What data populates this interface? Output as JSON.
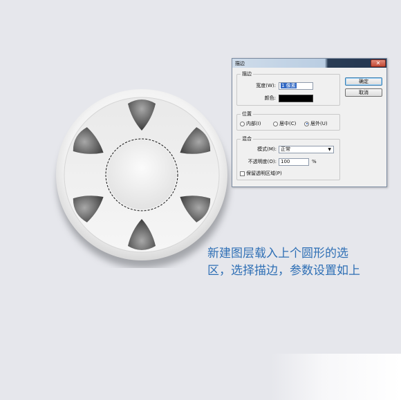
{
  "dialog": {
    "title": "描边",
    "close_symbol": "✕",
    "stroke_group": {
      "label": "描边",
      "width_label": "宽度(W):",
      "width_value": "1 像素",
      "color_label": "颜色:",
      "color_value": "#000000"
    },
    "position_group": {
      "label": "位置",
      "options": [
        "内部(I)",
        "居中(C)",
        "居外(U)"
      ],
      "selected": "居外(U)"
    },
    "blend_group": {
      "label": "混合",
      "mode_label": "模式(M):",
      "mode_value": "正常",
      "opacity_label": "不透明度(O):",
      "opacity_value": "100",
      "opacity_unit": "%",
      "preserve_label": "保留透明区域(P)"
    },
    "ok_label": "确定",
    "cancel_label": "取消"
  },
  "caption": {
    "line1": "新建图层载入上个圆形的选",
    "line2": "区，选择描边，参数设置如上"
  },
  "colors": {
    "background": "#e6e7ec",
    "caption": "#2e6fb5",
    "selection_highlight": "#3168c4"
  }
}
